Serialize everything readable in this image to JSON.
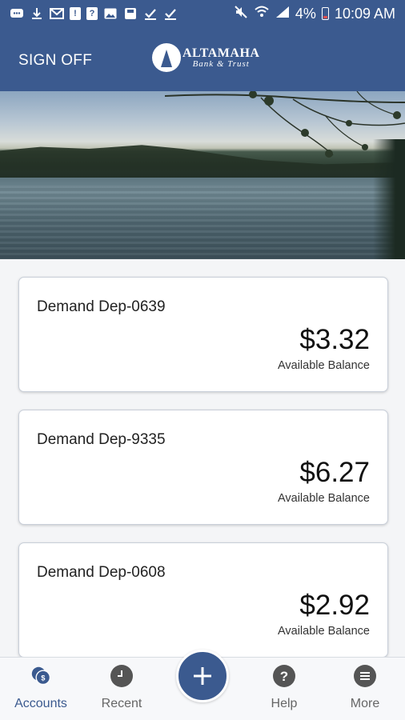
{
  "status_bar": {
    "battery": "4%",
    "time": "10:09 AM"
  },
  "header": {
    "sign_off_label": "SIGN OFF",
    "logo_name": "ALTAMAHA",
    "logo_sub": "Bank & Trust"
  },
  "accounts": [
    {
      "name": "Demand Dep-0639",
      "amount": "$3.32",
      "label": "Available Balance"
    },
    {
      "name": "Demand Dep-9335",
      "amount": "$6.27",
      "label": "Available Balance"
    },
    {
      "name": "Demand Dep-0608",
      "amount": "$2.92",
      "label": "Available Balance"
    }
  ],
  "nav": {
    "items": [
      {
        "label": "Accounts",
        "icon": "accounts-icon",
        "active": true
      },
      {
        "label": "Recent",
        "icon": "clock-icon",
        "active": false
      },
      {
        "label": "Help",
        "icon": "help-icon",
        "active": false
      },
      {
        "label": "More",
        "icon": "menu-icon",
        "active": false
      }
    ],
    "fab_icon": "plus-icon"
  },
  "colors": {
    "brand": "#3b5a8f",
    "nav_inactive": "#666666",
    "icon_gray": "#555555"
  }
}
